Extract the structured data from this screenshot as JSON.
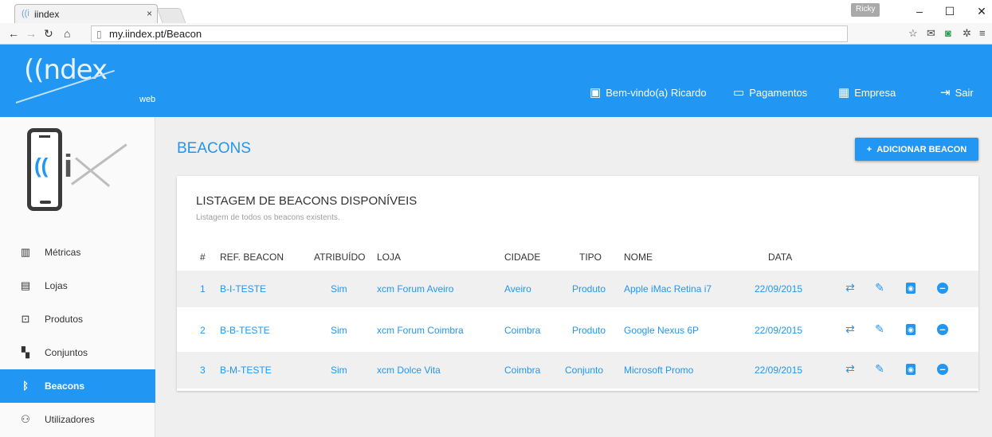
{
  "browser": {
    "tab_title": "iindex",
    "tab_close": "×",
    "user_badge": "Ricky",
    "minimize": "–",
    "maximize": "☐",
    "close": "✕",
    "url": "my.iindex.pt/Beacon"
  },
  "header": {
    "logo_text": "((ndex",
    "logo_sub": "web",
    "nav": [
      {
        "label": "Bem-vindo(a) Ricardo",
        "icon": "account-icon"
      },
      {
        "label": "Pagamentos",
        "icon": "credit-card-icon"
      },
      {
        "label": "Empresa",
        "icon": "company-icon"
      },
      {
        "label": "Sair",
        "icon": "logout-icon"
      }
    ]
  },
  "sidebar": {
    "items": [
      {
        "label": "Métricas",
        "icon": "chart-icon",
        "active": false
      },
      {
        "label": "Lojas",
        "icon": "store-icon",
        "active": false
      },
      {
        "label": "Produtos",
        "icon": "box-icon",
        "active": false
      },
      {
        "label": "Conjuntos",
        "icon": "grid-icon",
        "active": false
      },
      {
        "label": "Beacons",
        "icon": "bluetooth-icon",
        "active": true
      },
      {
        "label": "Utilizadores",
        "icon": "users-icon",
        "active": false
      }
    ]
  },
  "main": {
    "title": "BEACONS",
    "add_button": "ADICIONAR BEACON",
    "add_icon": "+",
    "card_title": "LISTAGEM DE BEACONS DISPONÍVEIS",
    "card_subtitle": "Listagem de todos os beacons existents.",
    "columns": [
      "#",
      "REF. BEACON",
      "ATRIBUÍDO",
      "LOJA",
      "CIDADE",
      "TIPO",
      "NOME",
      "DATA"
    ],
    "rows": [
      {
        "num": "1",
        "ref": "B-I-TESTE",
        "assigned": "Sim",
        "store": "xcm Forum Aveiro",
        "city": "Aveiro",
        "type": "Produto",
        "name": "Apple iMac Retina i7",
        "date": "22/09/2015"
      },
      {
        "num": "2",
        "ref": "B-B-TESTE",
        "assigned": "Sim",
        "store": "xcm Forum Coimbra",
        "city": "Coimbra",
        "type": "Produto",
        "name": "Google Nexus 6P",
        "date": "22/09/2015"
      },
      {
        "num": "3",
        "ref": "B-M-TESTE",
        "assigned": "Sim",
        "store": "xcm Dolce Vita",
        "city": "Coimbra",
        "type": "Conjunto",
        "name": "Microsoft Promo",
        "date": "22/09/2015"
      }
    ]
  }
}
